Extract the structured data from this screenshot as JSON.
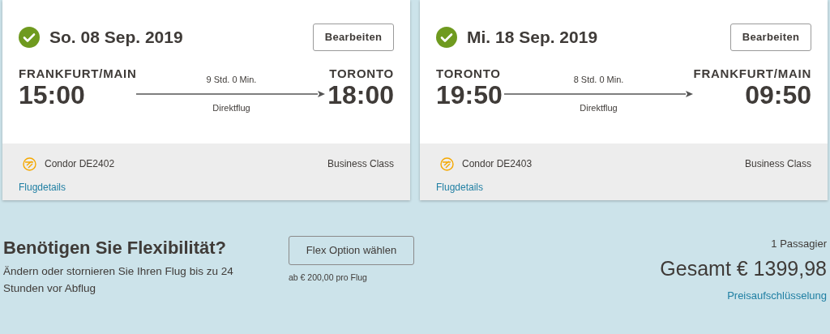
{
  "flights": [
    {
      "date": "So. 08 Sep. 2019",
      "edit_button": "Bearbeiten",
      "origin": {
        "city": "FRANKFURT/MAIN",
        "time": "15:00"
      },
      "duration": "9 Std. 0 Min.",
      "stops": "Direktflug",
      "destination": {
        "city": "TORONTO",
        "time": "18:00"
      },
      "airline": "Condor DE2402",
      "cabin": "Business Class",
      "details_link": "Flugdetails"
    },
    {
      "date": "Mi. 18 Sep. 2019",
      "edit_button": "Bearbeiten",
      "origin": {
        "city": "TORONTO",
        "time": "19:50"
      },
      "duration": "8 Std. 0 Min.",
      "stops": "Direktflug",
      "destination": {
        "city": "FRANKFURT/MAIN",
        "time": "09:50"
      },
      "airline": "Condor DE2403",
      "cabin": "Business Class",
      "details_link": "Flugdetails"
    }
  ],
  "flex": {
    "title": "Benötigen Sie Flexibilität?",
    "description": "Ändern oder stornieren Sie Ihren Flug bis zu 24 Stunden vor Abflug",
    "button": "Flex Option wählen",
    "price_note": "ab € 200,00 pro Flug"
  },
  "summary": {
    "passengers": "1 Passagier",
    "total": "Gesamt € 1399,98",
    "breakdown_link": "Preisaufschlüsselung"
  }
}
